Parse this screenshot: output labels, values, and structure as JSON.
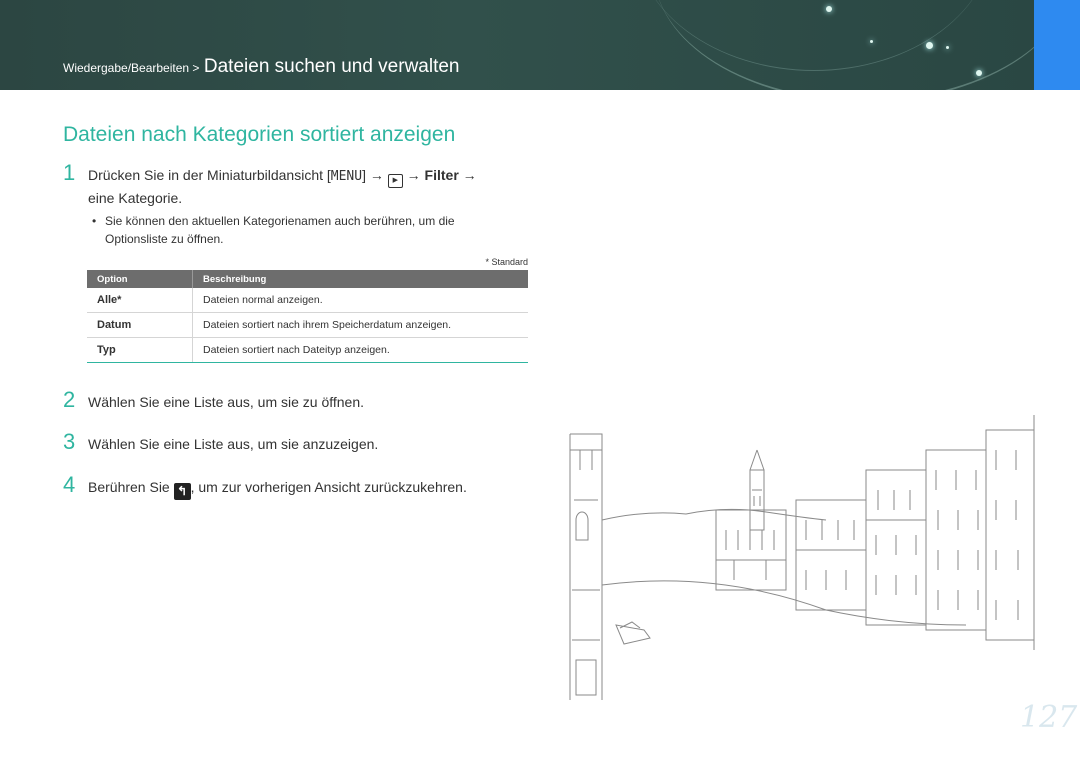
{
  "header": {
    "breadcrumb_section": "Wiedergabe/Bearbeiten >",
    "breadcrumb_page": "Dateien suchen und verwalten"
  },
  "title": "Dateien nach Kategorien sortiert anzeigen",
  "steps": [
    {
      "num": "1",
      "text_a": "Drücken Sie in der Miniaturbildansicht [",
      "menu": "MENU",
      "text_b": "] →",
      "play_icon": "play-icon",
      "arrow": "→",
      "filter": "Filter",
      "arrow2": "→",
      "text_c": "eine Kategorie."
    },
    {
      "num": "2",
      "text": "Wählen Sie eine Liste aus, um sie zu öffnen."
    },
    {
      "num": "3",
      "text": "Wählen Sie eine Liste aus, um sie anzuzeigen."
    },
    {
      "num": "4",
      "text_a": "Berühren Sie",
      "icon": "back-icon",
      "text_b": ", um zur vorherigen Ansicht zurückzukehren."
    }
  ],
  "bullet": "Sie können den aktuellen Kategorienamen auch berühren, um die Optionsliste zu öffnen.",
  "standard_note": "* Standard",
  "table": {
    "headers": [
      "Option",
      "Beschreibung"
    ],
    "rows": [
      {
        "option": "Alle*",
        "desc": "Dateien normal anzeigen."
      },
      {
        "option": "Datum",
        "desc": "Dateien sortiert nach ihrem Speicherdatum anzeigen."
      },
      {
        "option": "Typ",
        "desc": "Dateien sortiert nach Dateityp anzeigen."
      }
    ]
  },
  "page_number": "127",
  "colors": {
    "accent": "#2fb5a0",
    "header_bg": "#2c4642",
    "blue_tab": "#2e8af0"
  }
}
